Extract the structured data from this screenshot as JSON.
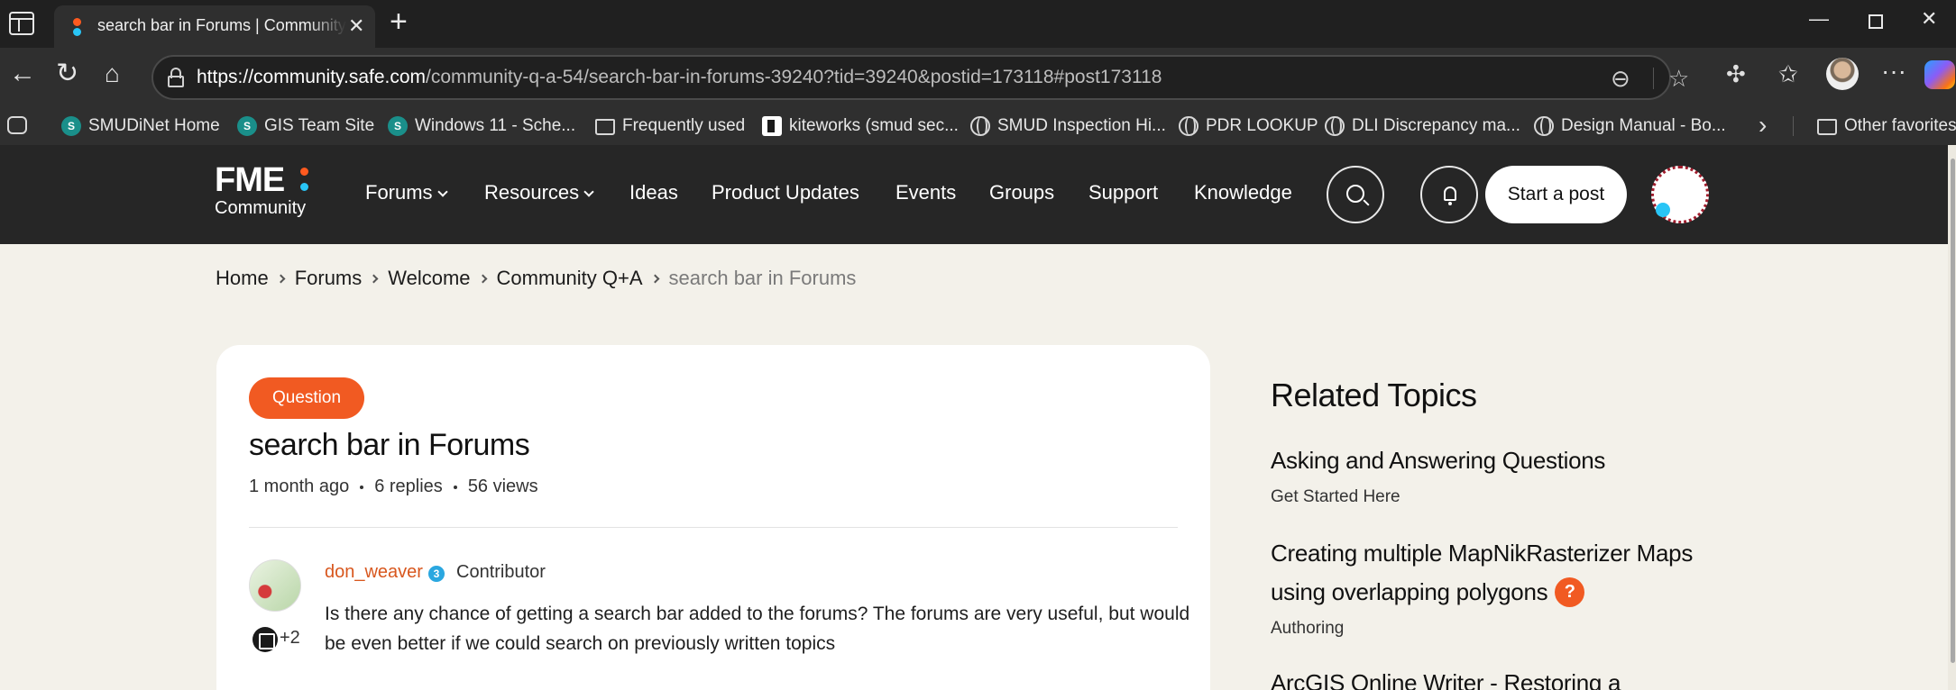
{
  "browser": {
    "tab_title": "search bar in Forums | Community",
    "url_host": "https://community.safe.com",
    "url_path": "/community-q-a-54/search-bar-in-forums-39240?tid=39240&postid=173118#post173118",
    "bookmarks": [
      {
        "label": "SMUDiNet Home",
        "icon": "sharepoint-icon"
      },
      {
        "label": "GIS Team Site",
        "icon": "sharepoint-icon"
      },
      {
        "label": "Windows 11 - Sche...",
        "icon": "sharepoint-icon"
      },
      {
        "label": "Frequently used",
        "icon": "folder-icon"
      },
      {
        "label": "kiteworks (smud sec...",
        "icon": "kiteworks-icon"
      },
      {
        "label": "SMUD Inspection Hi...",
        "icon": "globe-icon"
      },
      {
        "label": "PDR LOOKUP",
        "icon": "globe-icon"
      },
      {
        "label": "DLI Discrepancy ma...",
        "icon": "globe-icon"
      },
      {
        "label": "Design Manual - Bo...",
        "icon": "globe-icon"
      }
    ],
    "other_favorites": "Other favorites"
  },
  "site": {
    "logo_word": "FME",
    "logo_sub": "Community",
    "nav": [
      {
        "label": "Forums",
        "dropdown": true
      },
      {
        "label": "Resources",
        "dropdown": true
      },
      {
        "label": "Ideas"
      },
      {
        "label": "Product Updates"
      },
      {
        "label": "Events"
      },
      {
        "label": "Groups"
      },
      {
        "label": "Support"
      },
      {
        "label": "Knowledge"
      }
    ],
    "start_post": "Start a post"
  },
  "breadcrumb": [
    "Home",
    "Forums",
    "Welcome",
    "Community Q+A"
  ],
  "breadcrumb_current": "search bar in Forums",
  "post": {
    "badge": "Question",
    "title": "search bar in Forums",
    "age": "1 month ago",
    "replies": "6 replies",
    "views": "56 views",
    "author": "don_weaver",
    "author_level": "3",
    "author_role": "Contributor",
    "extra_badges": "+2",
    "body": "Is there any chance of getting a search bar added to the forums?  The forums are very useful, but would be even better if we could search on previously written topics"
  },
  "related": {
    "title": "Related Topics",
    "items": [
      {
        "title": "Asking and Answering Questions",
        "category": "Get Started Here",
        "question": false
      },
      {
        "title": "Creating multiple MapNikRasterizer Maps using overlapping polygons",
        "category": "Authoring",
        "question": true,
        "question_mark": "?"
      },
      {
        "title": "ArcGIS Online Writer - Restoring a",
        "category": "",
        "question": false
      }
    ]
  },
  "colors": {
    "accent_orange": "#f15a22",
    "accent_blue": "#29c5f6",
    "header_bg": "#262626",
    "page_bg": "#f3f1ea"
  }
}
